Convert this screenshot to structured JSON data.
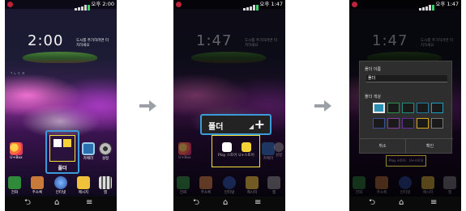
{
  "screens": [
    {
      "status_time": "오후 2:00",
      "clock": "2:00",
      "weather_text": "도시를 추가하려면 터치하세요",
      "location": "ㄱ ㄴ ㄷ ㄹ",
      "apps": {
        "ubox": "U+Box",
        "folder_label": "폴더",
        "camera": "카메라",
        "settings": "설정"
      },
      "dock": {
        "phone": "전화",
        "contacts": "주소록",
        "internet": "인터넷",
        "messages": "메시지",
        "apps": "앱"
      }
    },
    {
      "status_time": "오후 1:47",
      "clock": "1:47",
      "weather_text": "도시를 추가하려면 터치하세요",
      "folder_name": "폴더",
      "add_symbol": "+",
      "apps": {
        "ubox": "U+Box",
        "play_store": "Play 스토어",
        "uplus_store": "U+스토어",
        "camera": "카메라",
        "settings": "설정"
      },
      "dock": {
        "phone": "전화",
        "contacts": "주소록",
        "internet": "인터넷",
        "messages": "메시지",
        "apps": "앱"
      }
    },
    {
      "status_time": "오후 1:47",
      "clock": "1:47",
      "weather_text": "도시를 추가하려면 터치하세요",
      "dialog": {
        "name_heading": "폴더 이름",
        "name_value": "폴더",
        "color_heading": "폴더 색상",
        "cancel": "취소",
        "confirm": "확인"
      },
      "apps": {
        "play_store": "Play 스토어",
        "uplus_store": "U+스토어"
      },
      "dock": {
        "phone": "전화",
        "contacts": "주소록",
        "internet": "인터넷",
        "messages": "메시지",
        "apps": "앱"
      }
    }
  ],
  "colors": {
    "selection_blue": "#3a9bd8",
    "folder_yellow": "#f6e23a",
    "swatches": [
      "#2a8fb0",
      "#2a8f4a",
      "#1e6e6e",
      "#1f7ca0",
      "#1f6fb0",
      "#3a3f9a",
      "#8a3fa0",
      "#6a2a9a",
      "#d6a81a",
      "#1a1a1a"
    ],
    "arrow": "#9aa0a6"
  }
}
